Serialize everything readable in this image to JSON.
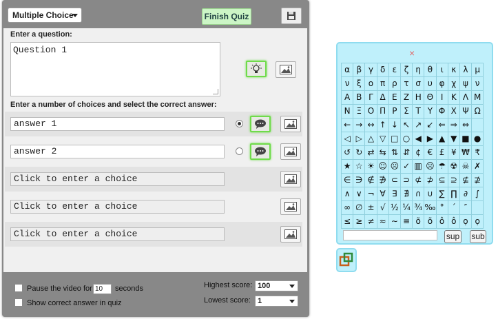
{
  "editor": {
    "type_select": "Multiple Choice",
    "finish_button": "Finish Quiz",
    "question_label": "Enter a question:",
    "question_text": "Question 1",
    "choices_label": "Enter a number of choices and select the correct answer:",
    "choices": [
      {
        "text": "answer 1",
        "selected": true
      },
      {
        "text": "answer 2",
        "selected": false
      },
      {
        "placeholder": "Click to enter a choice"
      },
      {
        "placeholder": "Click to enter a choice"
      },
      {
        "placeholder": "Click to enter a choice"
      }
    ]
  },
  "footer": {
    "pause_prefix": "Pause the video for",
    "pause_value": "10",
    "pause_suffix": "seconds",
    "show_answer": "Show correct answer in quiz",
    "highest_label": "Highest score:",
    "highest_value": "100",
    "lowest_label": "Lowest score:",
    "lowest_value": "1"
  },
  "keyboard": {
    "close": "×",
    "rows": [
      [
        "α",
        "β",
        "γ",
        "δ",
        "ε",
        "ζ",
        "η",
        "θ",
        "ι",
        "κ",
        "λ",
        "μ"
      ],
      [
        "ν",
        "ξ",
        "ο",
        "π",
        "ρ",
        "τ",
        "σ",
        "υ",
        "φ",
        "χ",
        "ψ",
        "ν"
      ],
      [
        "Α",
        "Β",
        "Γ",
        "Δ",
        "Ε",
        "Ζ",
        "Η",
        "Θ",
        "Ι",
        "Κ",
        "Λ",
        "Μ"
      ],
      [
        "Ν",
        "Ξ",
        "Ο",
        "Π",
        "Ρ",
        "Σ",
        "Τ",
        "Υ",
        "Φ",
        "Χ",
        "Ψ",
        "Ω"
      ],
      [
        "←",
        "→",
        "↔",
        "↑",
        "↓",
        "↖",
        "↗",
        "↙",
        "⇐",
        "⇒",
        "⇔"
      ],
      [
        "◁",
        "▷",
        "△",
        "▽",
        "□",
        "○",
        "◀",
        "▶",
        "▲",
        "▼",
        "■",
        "●"
      ],
      [
        "↺",
        "↻",
        "⇄",
        "⇆",
        "⇅",
        "⇵",
        "¢",
        "€",
        "£",
        "¥",
        "₩",
        "₹"
      ],
      [
        "★",
        "☆",
        "☀",
        "☺",
        "☹",
        "✓",
        "▥",
        "☹",
        "☂",
        "☢",
        "☠",
        "✗"
      ],
      [
        "∈",
        "∋",
        "∉",
        "∌",
        "⊂",
        "⊃",
        "⊄",
        "⊅",
        "⊆",
        "⊇",
        "⊈",
        "⊉"
      ],
      [
        "∧",
        "∨",
        "¬",
        "∀",
        "∃",
        "∄",
        "∩",
        "∪",
        "∑",
        "∏",
        "∂",
        "∫"
      ],
      [
        "∞",
        "∅",
        "±",
        "√",
        "½",
        "¼",
        "¾",
        "‰",
        "°",
        "´",
        "″"
      ],
      [
        "≤",
        "≥",
        "≠",
        "≈",
        "∼",
        "≡",
        "õ",
        "õ",
        "ô",
        "ô",
        "ọ",
        "ọ"
      ]
    ],
    "sup_label": "sup",
    "sub_label": "sub"
  }
}
